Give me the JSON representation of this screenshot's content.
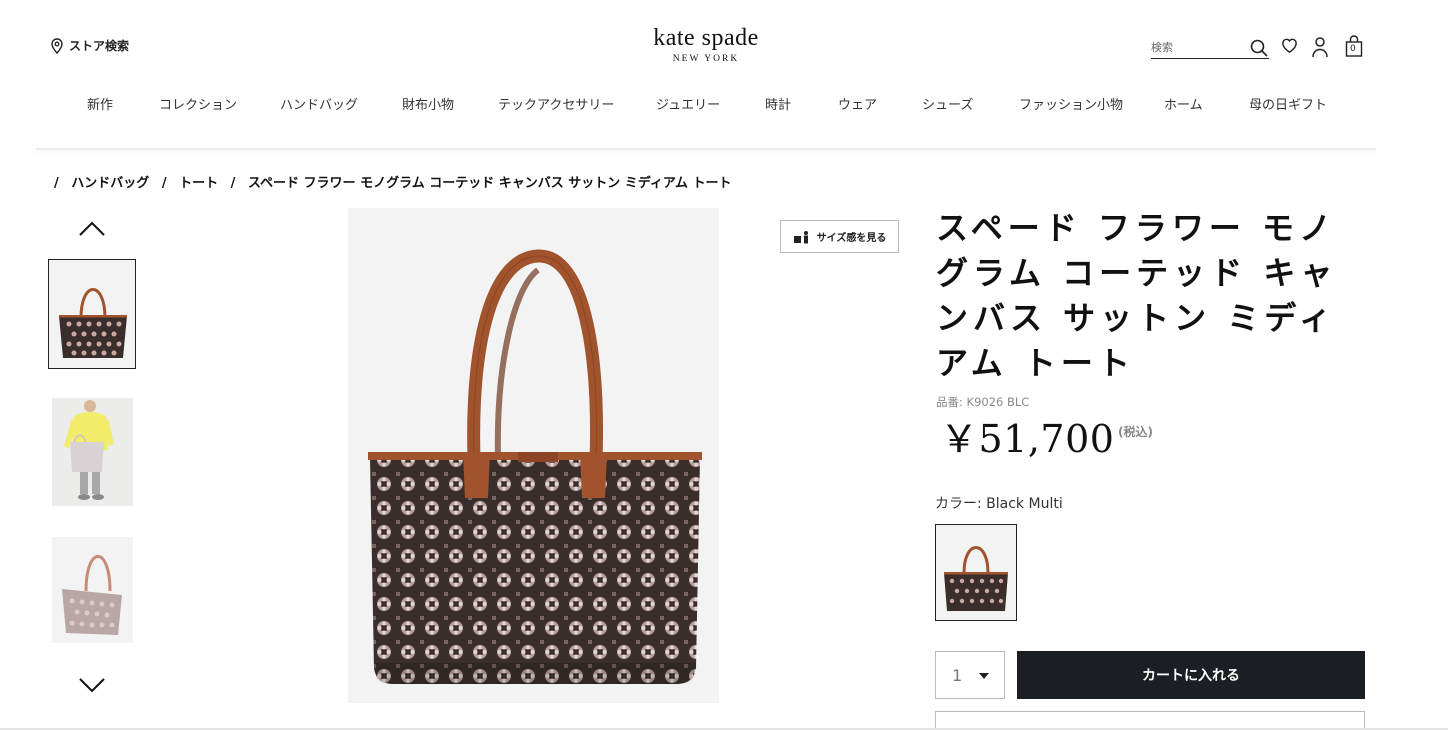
{
  "header": {
    "store_search": "ストア検索",
    "brand": "kate spade",
    "brand_sub": "NEW YORK",
    "search_placeholder": "検索",
    "cart_count": "0"
  },
  "nav": {
    "items": [
      "新作",
      "コレクション",
      "ハンドバッグ",
      "財布小物",
      "テックアクセサリー",
      "ジュエリー",
      "時計",
      "ウェア",
      "シューズ",
      "ファッション小物",
      "ホーム",
      "母の日ギフト"
    ]
  },
  "breadcrumb": {
    "items": [
      "ハンドバッグ",
      "トート",
      "スペード フラワー モノグラム コーテッド キャンバス サットン ミディアム トート"
    ]
  },
  "product": {
    "size_button": "サイズ感を見る",
    "title": "スペード フラワー モノグラム コーテッド キャンバス サットン ミディアム トート",
    "sku": "品番: K9026 BLC",
    "price": "￥51,700",
    "tax": "(税込)",
    "color_label": "カラー: Black Multi",
    "quantity": "1",
    "add_to_cart": "カートに入れる"
  },
  "colors": {
    "cart_button": "#1b1e22",
    "bag_body": "#3a2e2c",
    "bag_leather": "#a0532c"
  }
}
